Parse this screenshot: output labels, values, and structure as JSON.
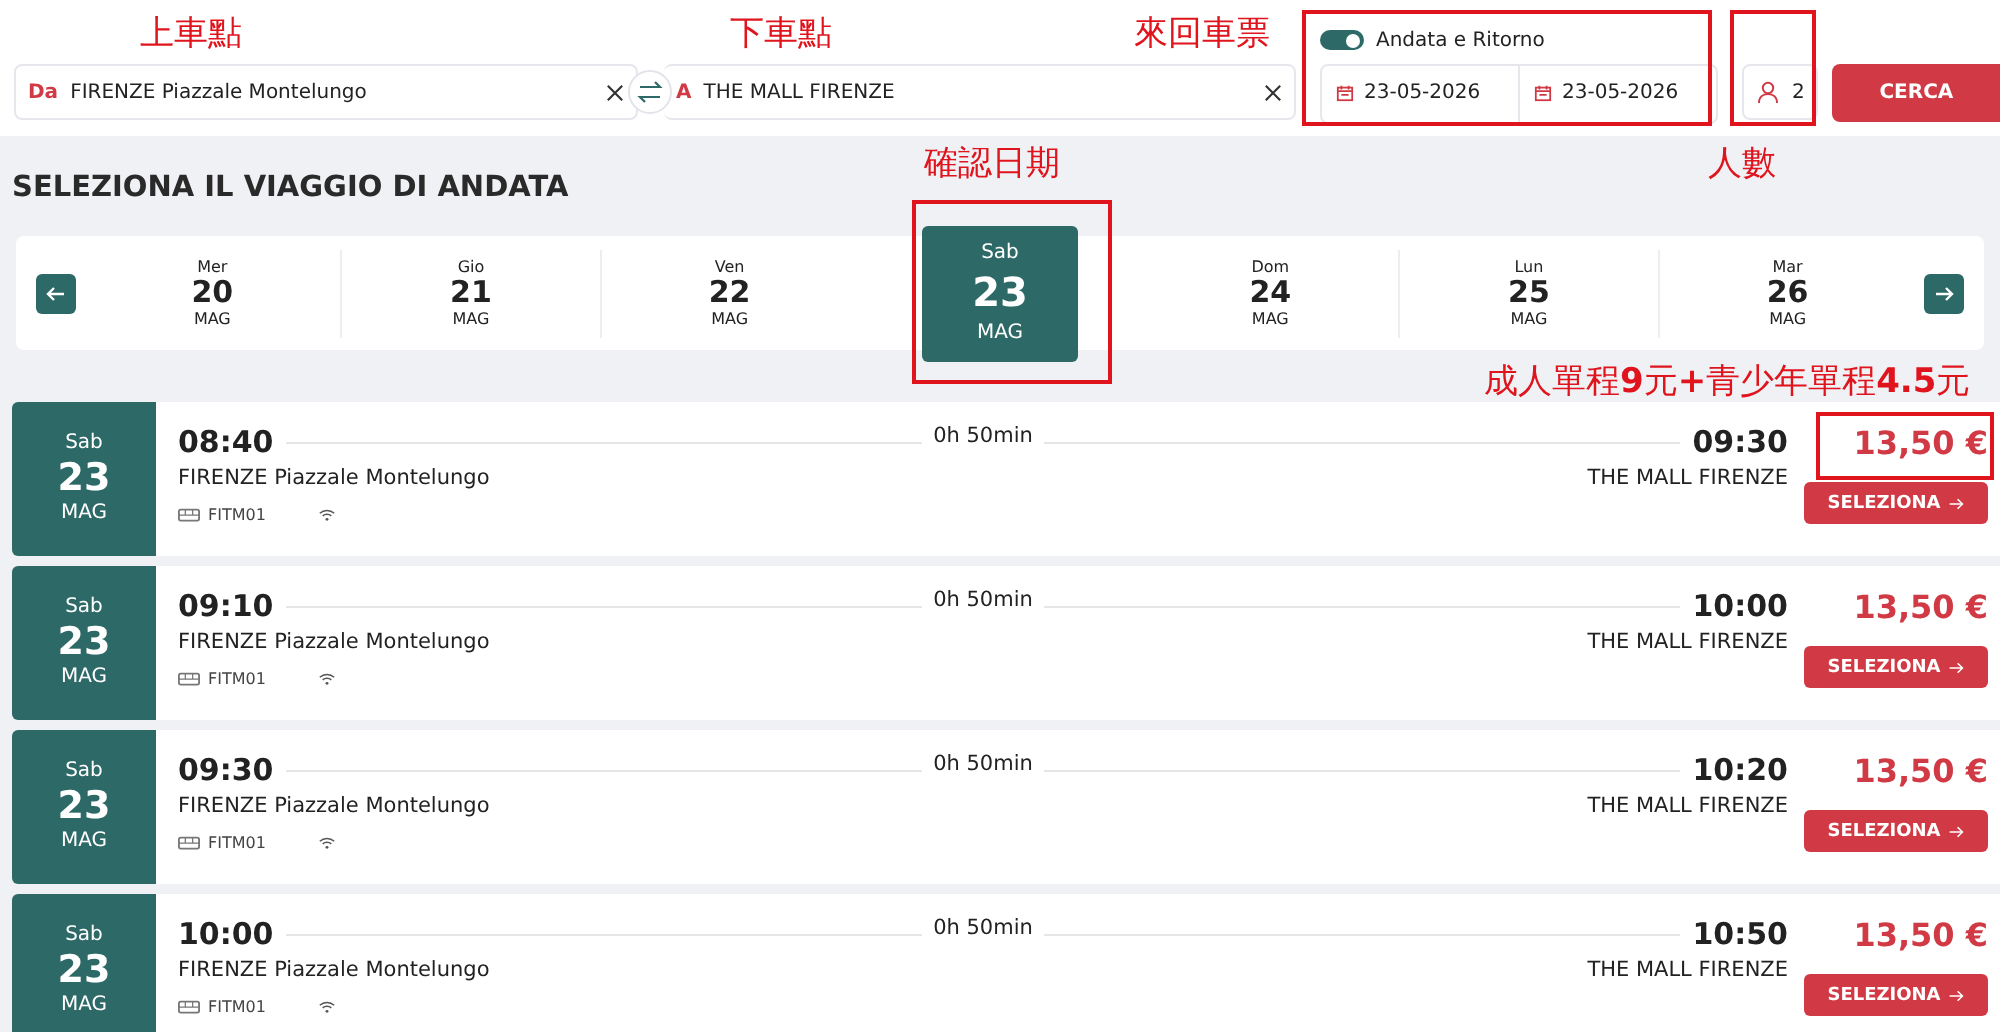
{
  "search": {
    "from_prefix": "Da",
    "from": "FIRENZE Piazzale Montelungo",
    "to_prefix": "A",
    "to": "THE MALL FIRENZE",
    "round_trip": {
      "label": "Andata e Ritorno",
      "on": true
    },
    "dates": [
      "23-05-2026",
      "23-05-2026"
    ],
    "passengers": "2",
    "button": "CERCA"
  },
  "heading": "SELEZIONA IL VIAGGIO DI ANDATA",
  "dates": [
    {
      "weekday": "Mer",
      "day": "20",
      "month": "MAG",
      "selected": false
    },
    {
      "weekday": "Gio",
      "day": "21",
      "month": "MAG",
      "selected": false
    },
    {
      "weekday": "Ven",
      "day": "22",
      "month": "MAG",
      "selected": false
    },
    {
      "weekday": "Sab",
      "day": "23",
      "month": "MAG",
      "selected": true
    },
    {
      "weekday": "Dom",
      "day": "24",
      "month": "MAG",
      "selected": false
    },
    {
      "weekday": "Lun",
      "day": "25",
      "month": "MAG",
      "selected": false
    },
    {
      "weekday": "Mar",
      "day": "26",
      "month": "MAG",
      "selected": false
    }
  ],
  "trips": [
    {
      "weekday": "Sab",
      "day": "23",
      "month": "MAG",
      "departure": "08:40",
      "from": "FIRENZE Piazzale Montelungo",
      "duration": "0h 50min",
      "arrival": "09:30",
      "to": "THE MALL FIRENZE",
      "bus_code": "FITM01",
      "price": "13,50 €",
      "button": "SELEZIONA"
    },
    {
      "weekday": "Sab",
      "day": "23",
      "month": "MAG",
      "departure": "09:10",
      "from": "FIRENZE Piazzale Montelungo",
      "duration": "0h 50min",
      "arrival": "10:00",
      "to": "THE MALL FIRENZE",
      "bus_code": "FITM01",
      "price": "13,50 €",
      "button": "SELEZIONA"
    },
    {
      "weekday": "Sab",
      "day": "23",
      "month": "MAG",
      "departure": "09:30",
      "from": "FIRENZE Piazzale Montelungo",
      "duration": "0h 50min",
      "arrival": "10:20",
      "to": "THE MALL FIRENZE",
      "bus_code": "FITM01",
      "price": "13,50 €",
      "button": "SELEZIONA"
    },
    {
      "weekday": "Sab",
      "day": "23",
      "month": "MAG",
      "departure": "10:00",
      "from": "FIRENZE Piazzale Montelungo",
      "duration": "0h 50min",
      "arrival": "10:50",
      "to": "THE MALL FIRENZE",
      "bus_code": "FITM01",
      "price": "13,50 €",
      "button": "SELEZIONA"
    }
  ],
  "annotations": [
    {
      "kind": "label",
      "text": "上車點"
    },
    {
      "kind": "label",
      "text": "下車點"
    },
    {
      "kind": "label",
      "text": "來回車票"
    },
    {
      "kind": "box"
    },
    {
      "kind": "box"
    },
    {
      "kind": "label",
      "text": "確認日期"
    },
    {
      "kind": "label",
      "text": "人數"
    },
    {
      "kind": "box"
    },
    {
      "kind": "label",
      "text": "成人單程**9**元**+**青少年單程**4.5**元"
    },
    {
      "kind": "box"
    }
  ]
}
